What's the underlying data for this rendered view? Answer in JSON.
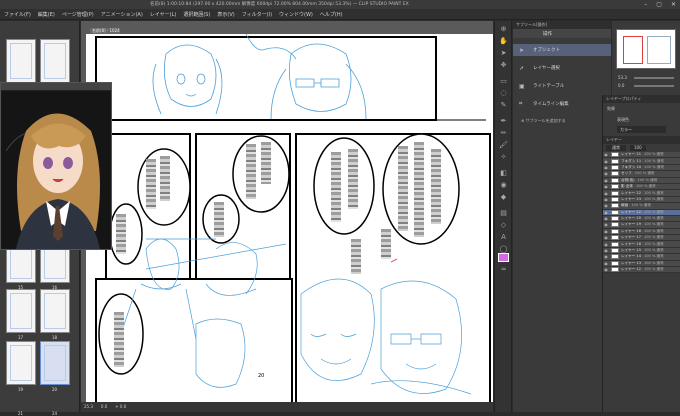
{
  "window": {
    "title": "名前(8) 1:00:10:84 (297.00 x 420.00mm 解像度 600dpi 72.00% 804.00mm 350dpi 53.3%) — CLIP STUDIO PAINT EX",
    "controls": [
      "–",
      "▢",
      "✕"
    ]
  },
  "menu": [
    "ファイル(F)",
    "編集(E)",
    "ページ管理(P)",
    "アニメーション(A)",
    "レイヤー(L)",
    "選択範囲(S)",
    "表示(V)",
    "フィルター(I)",
    "ウィンドウ(W)",
    "ヘルプ(H)"
  ],
  "document_tab": "名前(8) · 1024 ×",
  "pages_panel": {
    "page_numbers": [
      "15",
      "16",
      "17",
      "18",
      "19",
      "20",
      "21",
      "24"
    ]
  },
  "canvas": {
    "page_number": "20"
  },
  "statusbar": {
    "zoom": "25.3",
    "angle": "0.0",
    "coords": "+ 0.0"
  },
  "subtool_panel": {
    "header": "サブツール[操作]",
    "tab": "操作",
    "items": [
      {
        "icon": "cursor-icon",
        "label": "オブジェクト",
        "selected": true
      },
      {
        "icon": "layer-select-icon",
        "label": "レイヤー選択",
        "selected": false
      },
      {
        "icon": "lightbox-icon",
        "label": "ライトテーブル",
        "selected": false
      },
      {
        "icon": "timeline-icon",
        "label": "タイムライン編集",
        "selected": false
      }
    ],
    "add_label": "サブツールを追加する"
  },
  "navigator": {
    "zoom": "53.3",
    "angle": "0.0"
  },
  "layer_property": {
    "header": "レイヤープロパティ",
    "effect_label": "効果",
    "color_label": "表現色",
    "color_value": "カラー"
  },
  "layers_panel": {
    "header": "レイヤー",
    "blend": "通常",
    "opacity": "100",
    "rows": [
      {
        "name": "100 % 通常",
        "sub": "レイヤー 21",
        "sel": false
      },
      {
        "name": "100 % 通常",
        "sub": "フキダシ 11",
        "sel": false
      },
      {
        "name": "100 % 通常",
        "sub": "フキダシ 10",
        "sel": false
      },
      {
        "name": "100 % 通常",
        "sub": "セリフ",
        "sel": false
      },
      {
        "name": "100 % 通常",
        "sub": "台詞(仮)",
        "sel": false
      },
      {
        "name": "100 % 通常",
        "sub": "影 全体",
        "sel": false
      },
      {
        "name": "100 % 通常",
        "sub": "レイヤー 22",
        "sel": false
      },
      {
        "name": "100 % 通常",
        "sub": "レイヤー 23",
        "sel": false
      },
      {
        "name": "100 % 通常",
        "sub": "線画",
        "sel": false
      },
      {
        "name": "100 % 通常",
        "sub": "レイヤー 22",
        "sel": true
      },
      {
        "name": "100 % 通常",
        "sub": "レイヤー 20",
        "sel": false
      },
      {
        "name": "100 % 通常",
        "sub": "レイヤー 19",
        "sel": false
      },
      {
        "name": "100 % 通常",
        "sub": "レイヤー 18",
        "sel": false
      },
      {
        "name": "100 % 通常",
        "sub": "レイヤー 17",
        "sel": false
      },
      {
        "name": "100 % 通常",
        "sub": "レイヤー 16",
        "sel": false
      },
      {
        "name": "100 % 通常",
        "sub": "レイヤー 15",
        "sel": false
      },
      {
        "name": "100 % 通常",
        "sub": "レイヤー 14",
        "sel": false
      },
      {
        "name": "100 % 通常",
        "sub": "レイヤー 13",
        "sel": false
      },
      {
        "name": "100 % 通常",
        "sub": "レイヤー 12",
        "sel": false
      }
    ]
  },
  "colors": {
    "accent_selection": "#5b6f9b",
    "sketch_blue": "#4a9fd8",
    "panel_bg": "#3a3a3a"
  }
}
